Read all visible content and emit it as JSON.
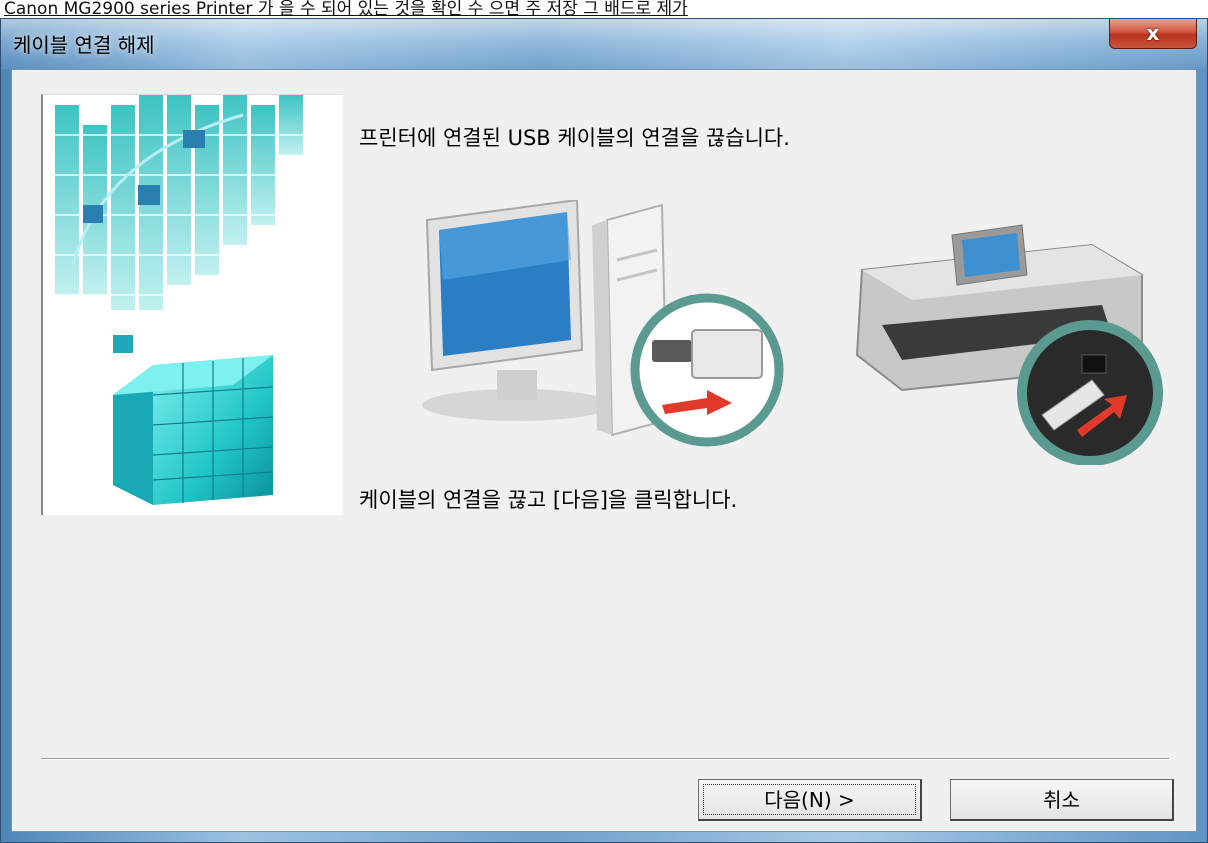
{
  "top_caption": "Canon MG2900 series Printer 가 을 수 되어 있는 것을 확인 수 으면 주 저장 그 배드로 제가",
  "window": {
    "title": "케이블 연결 해제",
    "close_label": "x"
  },
  "content": {
    "instruction_1": "프린터에 연결된 USB 케이블의 연결을 끊습니다.",
    "instruction_2": "케이블의 연결을 끊고 [다음]을 클릭합니다."
  },
  "buttons": {
    "next_label": "다음(N) >",
    "cancel_label": "취소"
  },
  "illustrations": {
    "left": "computer-usb-unplug",
    "right": "printer-usb-unplug"
  },
  "colors": {
    "accent_cyan": "#2ec9c9",
    "arrow_red": "#e23a2a",
    "close_red": "#c8482f",
    "dialog_bg": "#f0f0f0"
  }
}
